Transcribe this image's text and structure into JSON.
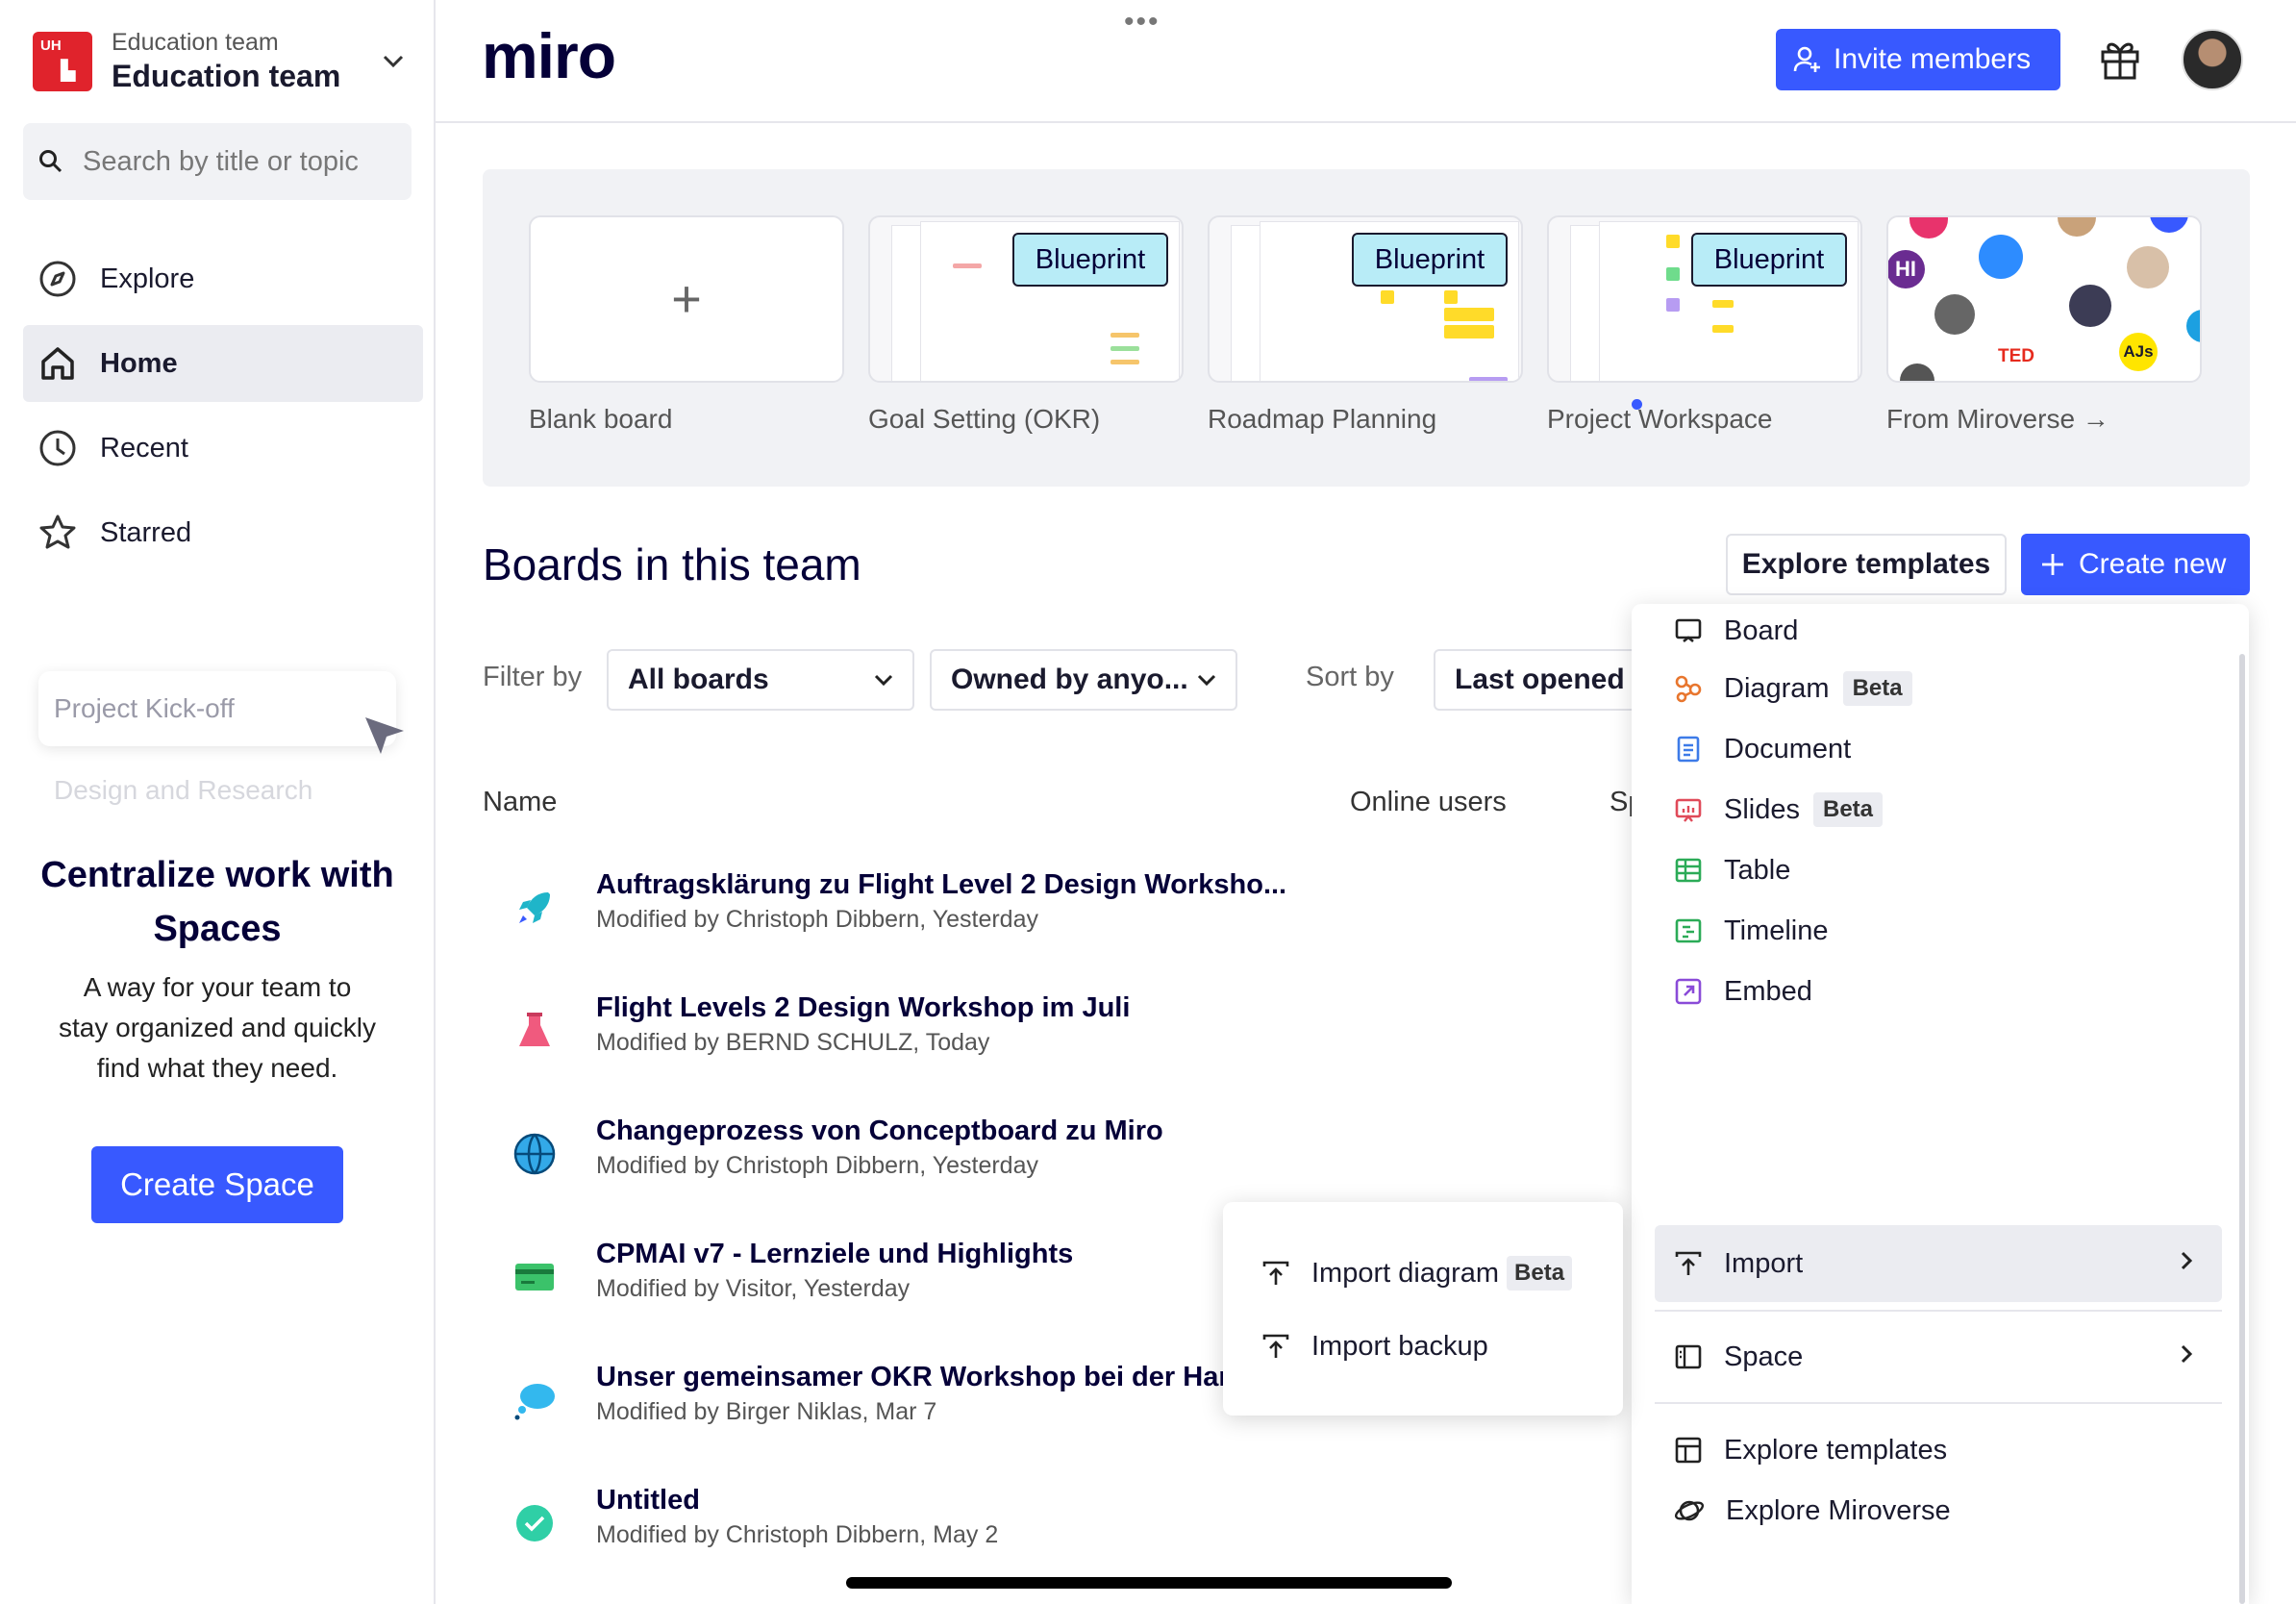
{
  "team": {
    "subtitle": "Education team",
    "name": "Education team",
    "logo_text": "UH"
  },
  "search": {
    "placeholder": "Search by title or topic"
  },
  "nav": [
    {
      "label": "Explore",
      "icon": "compass-icon"
    },
    {
      "label": "Home",
      "icon": "home-icon",
      "active": true
    },
    {
      "label": "Recent",
      "icon": "clock-icon"
    },
    {
      "label": "Starred",
      "icon": "star-icon"
    }
  ],
  "promo": {
    "card_text": "Project Kick-off",
    "faded_text": "Design and Research",
    "title": "Centralize work with Spaces",
    "description": "A way for your team to stay organized and quickly find what they need.",
    "button": "Create Space"
  },
  "header": {
    "logo": "miro",
    "invite_label": "Invite members",
    "more": "•••"
  },
  "templates": [
    {
      "label": "Blank board",
      "badge": ""
    },
    {
      "label": "Goal Setting (OKR)",
      "badge": "Blueprint"
    },
    {
      "label": "Roadmap Planning",
      "badge": "Blueprint"
    },
    {
      "label": "Project Workspace",
      "badge": "Blueprint"
    },
    {
      "label": "From Miroverse →",
      "badge": ""
    }
  ],
  "miroverse": {
    "ted": "TED",
    "hi": "HI",
    "ajs": "AJs"
  },
  "boards": {
    "title": "Boards in this team",
    "explore_label": "Explore templates",
    "create_label": "Create new",
    "filter_label": "Filter by",
    "filter_value": "All boards",
    "owner_value": "Owned by anyo...",
    "sort_label": "Sort by",
    "sort_value": "Last opened",
    "col_name": "Name",
    "col_online": "Online users",
    "col_space": "Sp"
  },
  "rows": [
    {
      "title": "Auftragsklärung zu Flight Level 2 Design Worksho...",
      "sub": "Modified by Christoph Dibbern, Yesterday"
    },
    {
      "title": "Flight Levels 2 Design Workshop im Juli",
      "sub": "Modified by BERND SCHULZ, Today"
    },
    {
      "title": "Changeprozess von Conceptboard zu Miro",
      "sub": "Modified by Christoph Dibbern, Yesterday"
    },
    {
      "title": "CPMAI v7 - Lernziele und Highlights",
      "sub": "Modified by Visitor, Yesterday"
    },
    {
      "title": "Unser gemeinsamer OKR Workshop bei der Har",
      "sub": "Modified by Birger Niklas, Mar 7"
    },
    {
      "title": "Untitled",
      "sub": "Modified by Christoph Dibbern, May 2"
    }
  ],
  "menu": [
    {
      "label": "Board",
      "badge": ""
    },
    {
      "label": "Diagram",
      "badge": "Beta"
    },
    {
      "label": "Document",
      "badge": ""
    },
    {
      "label": "Slides",
      "badge": "Beta"
    },
    {
      "label": "Table",
      "badge": ""
    },
    {
      "label": "Timeline",
      "badge": ""
    },
    {
      "label": "Embed",
      "badge": ""
    },
    {
      "label": "Import",
      "badge": ""
    },
    {
      "label": "Space",
      "badge": ""
    },
    {
      "label": "Explore templates",
      "badge": ""
    },
    {
      "label": "Explore Miroverse",
      "badge": ""
    }
  ],
  "submenu": [
    {
      "label": "Import diagram",
      "badge": "Beta"
    },
    {
      "label": "Import backup",
      "badge": ""
    }
  ],
  "colors": {
    "accent": "#3859ff",
    "badge_bg": "#b8ecf7",
    "team_logo": "#e0232c"
  }
}
